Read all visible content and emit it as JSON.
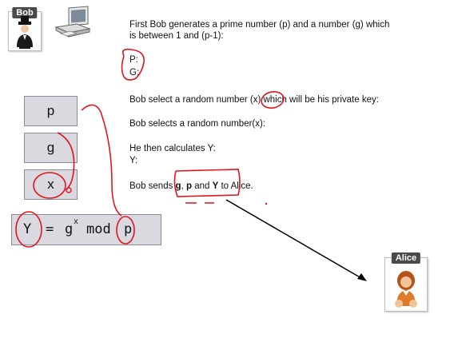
{
  "bob": {
    "label": "Bob"
  },
  "alice": {
    "label": "Alice"
  },
  "steps": {
    "step1_line1": "First Bob generates a prime number (p) and a number (g) which",
    "step1_line2": "is between 1 and (p-1):",
    "p_label": "P:",
    "g_label": "G:",
    "step2": "Bob select a random number (x) which will be his private key:",
    "step3": "Bob selects a random number(x):",
    "step4": "He then calculates Y:",
    "y_label": "Y:",
    "send_prefix": "Bob sends ",
    "send_g": "g",
    "send_sep1": ", ",
    "send_p": "p",
    "send_sep2": " and ",
    "send_y": "Y",
    "send_suffix": " to Alice."
  },
  "boxes": {
    "p": "p",
    "g": "g",
    "x": "x"
  },
  "formula": {
    "y": "Y",
    "eq": "=",
    "g": "g",
    "exp": "x",
    "mod": "mod",
    "p": "p"
  },
  "colors": {
    "annotation": "#e0141e",
    "box_fill": "#d9d9df",
    "label_bg": "#4a4a4a"
  },
  "icons": [
    "bob-avatar-icon",
    "computer-icon",
    "alice-avatar-icon"
  ]
}
